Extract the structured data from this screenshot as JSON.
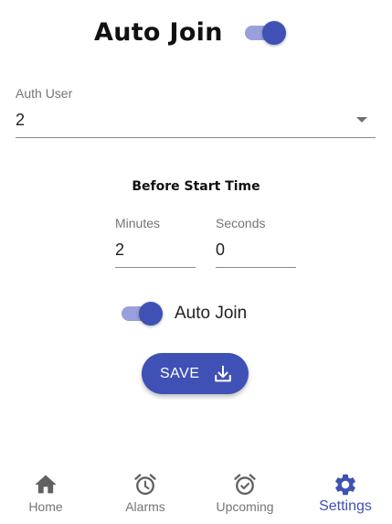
{
  "header": {
    "title": "Auto Join",
    "toggle_on": true
  },
  "auth_user": {
    "label": "Auth User",
    "value": "2"
  },
  "before_start": {
    "title": "Before Start Time",
    "minutes_label": "Minutes",
    "minutes_value": "2",
    "seconds_label": "Seconds",
    "seconds_value": "0"
  },
  "auto_join_toggle": {
    "label": "Auto Join",
    "on": true
  },
  "save_button": {
    "label": "SAVE",
    "icon": "download-icon"
  },
  "bottom_nav": {
    "items": [
      {
        "label": "Home",
        "icon": "home-icon",
        "active": false
      },
      {
        "label": "Alarms",
        "icon": "alarm-icon",
        "active": false
      },
      {
        "label": "Upcoming",
        "icon": "alarm-check-icon",
        "active": false
      },
      {
        "label": "Settings",
        "icon": "gear-icon",
        "active": true
      }
    ]
  },
  "colors": {
    "primary": "#3f51b5",
    "switch_track": "#9aa0dc",
    "inactive_nav": "#757575"
  }
}
